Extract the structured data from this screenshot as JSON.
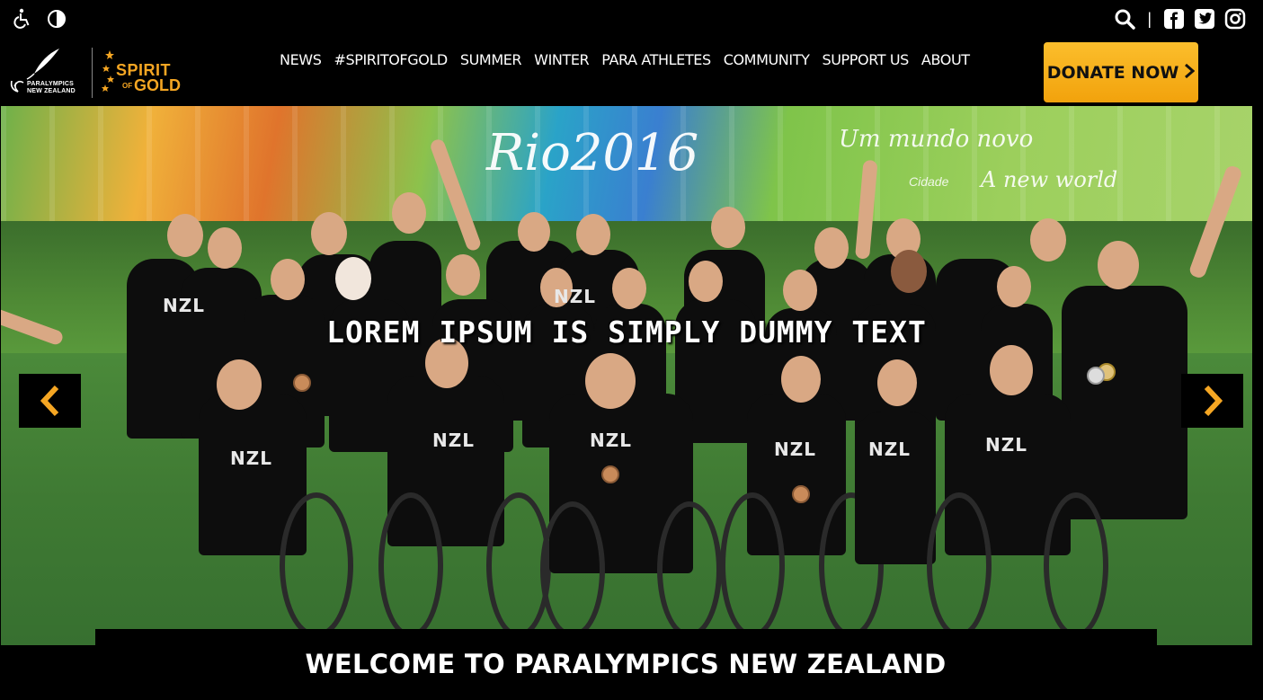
{
  "utility": {
    "accessibility_icon": "wheelchair-icon",
    "contrast_icon": "contrast-icon",
    "search_icon": "search-icon",
    "separator": "|",
    "social": [
      "facebook-icon",
      "twitter-icon",
      "instagram-icon"
    ]
  },
  "logos": {
    "paralympics": "PARALYMPICS\nNEW ZEALAND",
    "spirit_of_gold": {
      "line1": "SPIRIT",
      "of": "OF",
      "line2": "GOLD"
    }
  },
  "nav": {
    "items": [
      "NEWS",
      "#SPIRITOFGOLD",
      "SUMMER",
      "WINTER",
      "PARA ATHLETES",
      "COMMUNITY",
      "SUPPORT US",
      "ABOUT"
    ]
  },
  "donate": {
    "label": "DONATE NOW",
    "arrow": "›"
  },
  "hero": {
    "caption": "LOREM IPSUM IS SIMPLY DUMMY TEXT",
    "banner_main": "Rio2016",
    "banner_sub1": "Um mundo novo",
    "banner_sub2": "A new world",
    "banner_sub3": "Cidade",
    "shirt_text": "NZL",
    "prev_label": "‹",
    "next_label": "›"
  },
  "welcome": {
    "title": "WELCOME TO PARALYMPICS NEW ZEALAND"
  },
  "colors": {
    "accent": "#f5a623",
    "background": "#000000",
    "text": "#ffffff"
  }
}
